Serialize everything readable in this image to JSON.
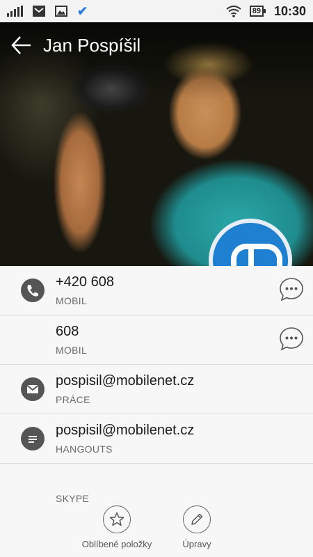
{
  "status_bar": {
    "battery": "89",
    "time": "10:30"
  },
  "header": {
    "contact_name": "Jan Pospíšil"
  },
  "entries": [
    {
      "value": "+420 608",
      "label": "MOBIL"
    },
    {
      "value": "608",
      "label": "MOBIL"
    },
    {
      "value": "pospisil@mobilenet.cz",
      "label": "PRÁCE"
    },
    {
      "value": "pospisil@mobilenet.cz",
      "label": "HANGOUTS"
    },
    {
      "value": "",
      "label": "SKYPE"
    }
  ],
  "actions": {
    "favorites_label": "Oblíbené položky",
    "edit_label": "Úpravy"
  },
  "colors": {
    "status_check": "#2d7bd6",
    "badge": "#1f7fd0"
  }
}
